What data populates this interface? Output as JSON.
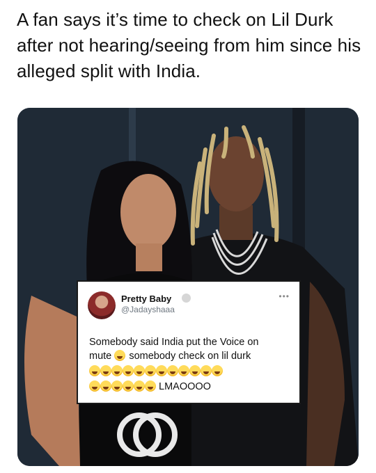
{
  "headline": "A fan says it’s time to check on Lil Durk after not hearing/seeing from him since his alleged split with India.",
  "tweet": {
    "author_name": "Pretty Baby",
    "author_handle": "@Jadayshaaa",
    "more_label": "•••",
    "text_line1": "Somebody said India put the Voice on",
    "text_line2_a": "mute",
    "text_line2_b": "somebody check on lil durk",
    "trailing_text": "LMAOOOO",
    "emoji_icon": "face-with-tears-of-joy-icon",
    "emoji_row1_count": 12,
    "emoji_row2_count": 6
  },
  "colors": {
    "photo_bg": "#1d2733",
    "card_border": "#1a1a1a",
    "handle_gray": "#6e7780"
  }
}
